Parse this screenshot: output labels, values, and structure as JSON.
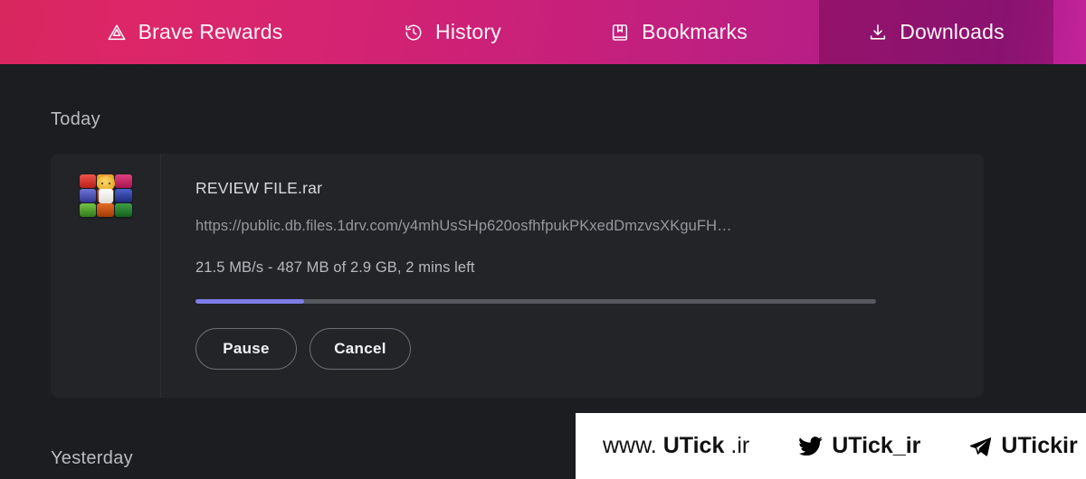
{
  "header": {
    "tabs": [
      {
        "id": "brave-rewards",
        "label": "Brave Rewards",
        "icon": "brave-triangle-icon",
        "active": false
      },
      {
        "id": "history",
        "label": "History",
        "icon": "history-clock-icon",
        "active": false
      },
      {
        "id": "bookmarks",
        "label": "Bookmarks",
        "icon": "bookmark-book-icon",
        "active": false
      },
      {
        "id": "downloads",
        "label": "Downloads",
        "icon": "download-arrow-icon",
        "active": true
      }
    ],
    "gradient_from": "#d8265e",
    "gradient_to": "#c42399",
    "active_tab_overlay": "#8b1e72"
  },
  "sections": {
    "today_label": "Today",
    "yesterday_label": "Yesterday"
  },
  "download": {
    "icon_name": "winrar-archive-icon",
    "file_name": "REVIEW FILE.rar",
    "url": "https://public.db.files.1drv.com/y4mhUsSHp620osfhfpukPKxedDmzvsXKguFH…",
    "status": "21.5 MB/s - 487 MB of 2.9 GB, 2 mins left",
    "speed": "21.5 MB/s",
    "downloaded": "487 MB",
    "total_size": "2.9 GB",
    "time_left": "2 mins left",
    "progress_percent": 16,
    "progress_fill_color": "#7c7ce8",
    "progress_track_color": "#55585e",
    "pause_label": "Pause",
    "cancel_label": "Cancel"
  },
  "watermark": {
    "site": {
      "prefix": "www.",
      "brand": "UTick",
      "suffix": ".ir"
    },
    "twitter": {
      "icon": "twitter-bird-icon",
      "handle": "UTick_ir"
    },
    "telegram": {
      "icon": "telegram-plane-icon",
      "handle": "UTickir"
    }
  }
}
